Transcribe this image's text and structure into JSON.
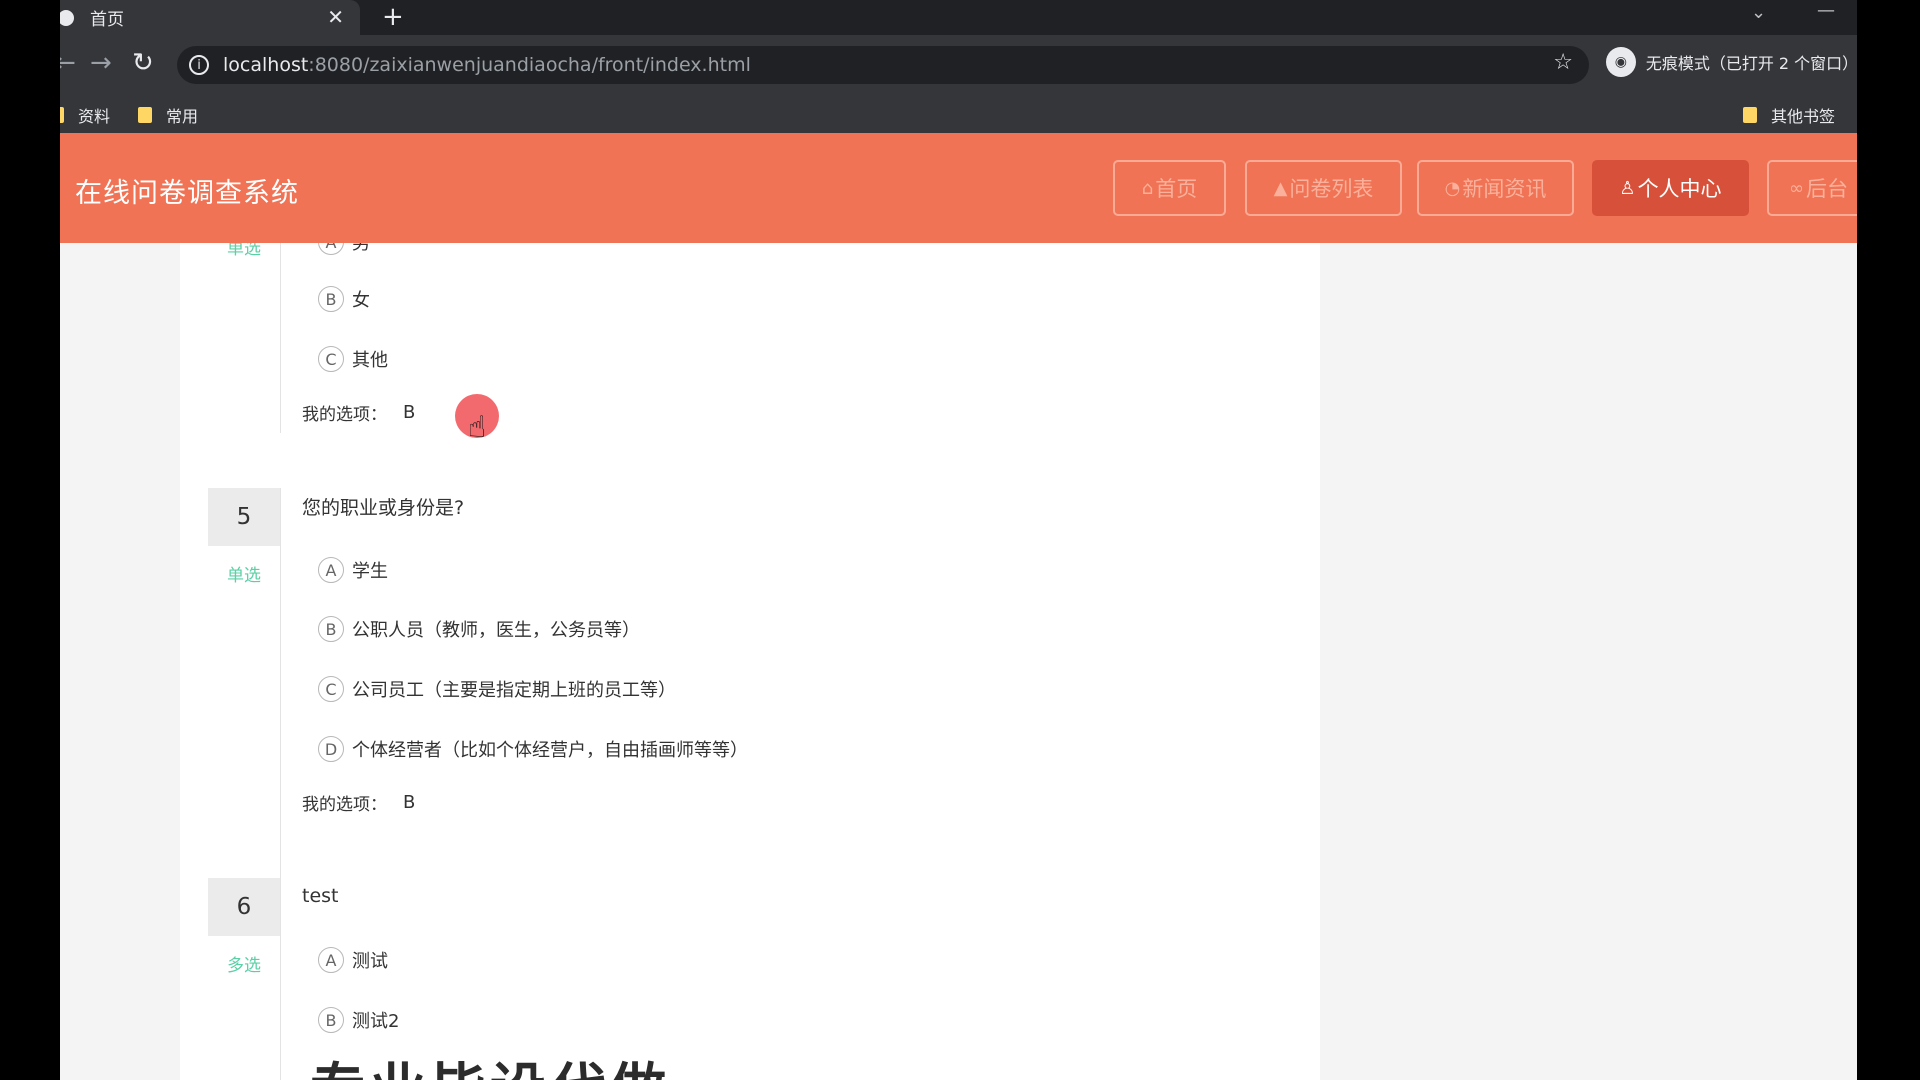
{
  "browser": {
    "tab_title": "首页",
    "url_host": "localhost",
    "url_path": ":8080/zaixianwenjuandiaocha/front/index.html",
    "incognito_label": "无痕模式（已打开 2 个窗口）",
    "bookmarks": [
      "资料",
      "常用"
    ],
    "other_bookmarks": "其他书签"
  },
  "site": {
    "title": "在线问卷调查系统",
    "nav": [
      {
        "label": "首页",
        "icon": "home-icon"
      },
      {
        "label": "问卷列表",
        "icon": "graduation-cap-icon"
      },
      {
        "label": "新闻资讯",
        "icon": "news-icon"
      },
      {
        "label": "个人中心",
        "icon": "user-icon"
      },
      {
        "label": "后台",
        "icon": "link-icon"
      }
    ]
  },
  "questions": [
    {
      "type": "单选",
      "options": [
        {
          "letter": "A",
          "text": "男"
        },
        {
          "letter": "B",
          "text": "女"
        },
        {
          "letter": "C",
          "text": "其他"
        }
      ],
      "my_choice_label": "我的选项：",
      "my_choice": "B"
    },
    {
      "number": "5",
      "title": "您的职业或身份是?",
      "type": "单选",
      "options": [
        {
          "letter": "A",
          "text": "学生"
        },
        {
          "letter": "B",
          "text": "公职人员（教师，医生，公务员等）"
        },
        {
          "letter": "C",
          "text": "公司员工（主要是指定期上班的员工等）"
        },
        {
          "letter": "D",
          "text": "个体经营者（比如个体经营户，自由插画师等等）"
        }
      ],
      "my_choice_label": "我的选项：",
      "my_choice": "B"
    },
    {
      "number": "6",
      "title": "test",
      "type": "多选",
      "options": [
        {
          "letter": "A",
          "text": "测试"
        },
        {
          "letter": "B",
          "text": "测试2"
        }
      ]
    }
  ],
  "overlay_caption": "专业毕设代做"
}
